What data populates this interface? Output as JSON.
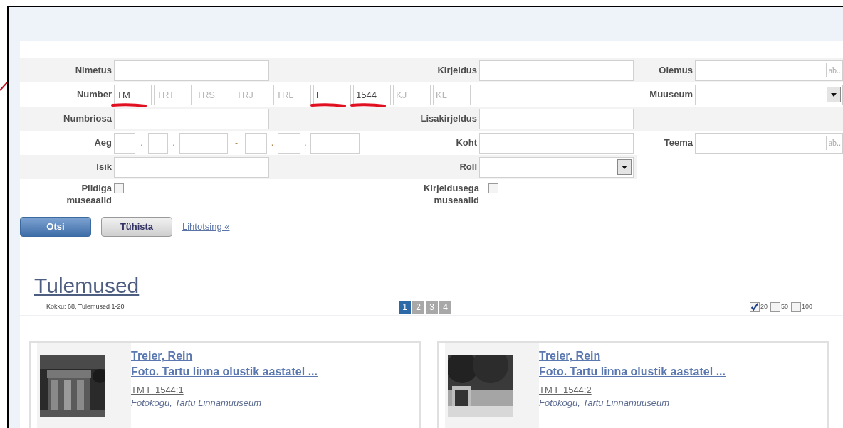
{
  "search_form": {
    "name": {
      "label": "Nimetus"
    },
    "description": {
      "label": "Kirjeldus"
    },
    "essence": {
      "label": "Olemus",
      "hint": "ab.."
    },
    "number": {
      "label": "Number",
      "parts": [
        {
          "value": "TM",
          "marked": true
        },
        {
          "placeholder": "TRT",
          "marked": false
        },
        {
          "placeholder": "TRS",
          "marked": false
        },
        {
          "placeholder": "TRJ",
          "marked": false
        },
        {
          "placeholder": "TRL",
          "marked": false
        },
        {
          "value": "F",
          "marked": true
        },
        {
          "value": "1544",
          "marked": true
        },
        {
          "placeholder": "KJ",
          "marked": false
        },
        {
          "placeholder": "KL",
          "marked": false
        }
      ]
    },
    "museum": {
      "label": "Muuseum"
    },
    "number_part": {
      "label": "Numbriosa"
    },
    "additional_description": {
      "label": "Lisakirjeldus"
    },
    "time": {
      "label": "Aeg",
      "separators": [
        ".",
        ".",
        "-",
        ".",
        "."
      ]
    },
    "place": {
      "label": "Koht"
    },
    "topic": {
      "label": "Teema",
      "hint": "ab.."
    },
    "person": {
      "label": "Isik"
    },
    "role": {
      "label": "Roll"
    },
    "with_picture": {
      "label": "Pildiga museaalid",
      "checked": false
    },
    "with_description": {
      "label": "Kirjeldusega museaalid",
      "checked": false
    }
  },
  "buttons": [
    {
      "label": "Otsi",
      "kind": "primary"
    },
    {
      "label": "Tühista",
      "kind": "secondary"
    }
  ],
  "simple_search_link": "Lihtotsing «",
  "results": {
    "title": "Tulemused",
    "summary": "Kokku: 68, Tulemused 1-20",
    "pages": [
      {
        "label": "1",
        "selected": true
      },
      {
        "label": "2",
        "selected": false
      },
      {
        "label": "3",
        "selected": false
      },
      {
        "label": "4",
        "selected": false
      }
    ],
    "page_sizes": [
      {
        "label": "20",
        "checked": true
      },
      {
        "label": "50",
        "checked": false
      },
      {
        "label": "100",
        "checked": false
      }
    ],
    "items": [
      {
        "author": "Treier, Rein",
        "title": "Foto. Tartu linna olustik aastatel ...",
        "number": "TM F 1544:1",
        "collection": "Fotokogu, Tartu Linnamuuseum",
        "kind": "pavilion"
      },
      {
        "author": "Treier, Rein",
        "title": "Foto. Tartu linna olustik aastatel ...",
        "number": "TM F 1544:2",
        "collection": "Fotokogu, Tartu Linnamuuseum",
        "kind": "gate"
      }
    ]
  }
}
